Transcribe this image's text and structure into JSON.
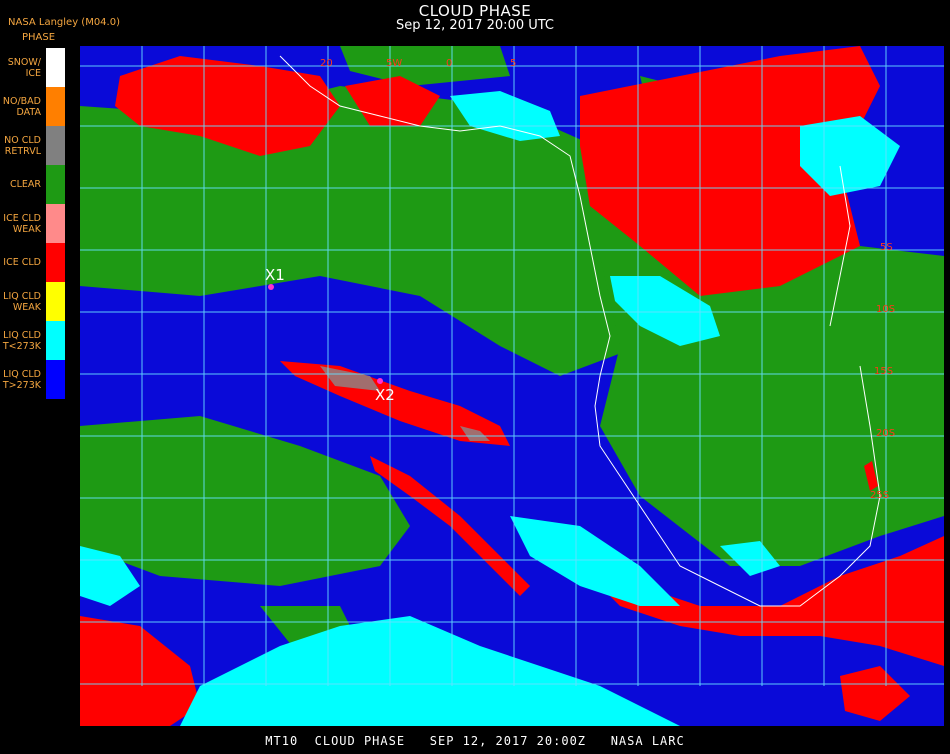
{
  "header": {
    "title": "CLOUD PHASE",
    "subtitle": "Sep 12, 2017 20:00 UTC",
    "producer": "NASA Langley (M04.0)",
    "legend_title": "PHASE"
  },
  "legend": [
    {
      "label": "SNOW/\nICE",
      "color": "#ffffff"
    },
    {
      "label": "NO/BAD\nDATA",
      "color": "#ff7f00"
    },
    {
      "label": "NO CLD\nRETRVL",
      "color": "#808080"
    },
    {
      "label": "CLEAR",
      "color": "#1e9a14"
    },
    {
      "label": "ICE CLD\nWEAK",
      "color": "#ff8a8a"
    },
    {
      "label": "ICE CLD",
      "color": "#ff0000"
    },
    {
      "label": "LIQ CLD\nWEAK",
      "color": "#ffff00"
    },
    {
      "label": "LIQ CLD\nT<273K",
      "color": "#00ffff"
    },
    {
      "label": "LIQ CLD\nT>273K",
      "color": "#0000ff"
    }
  ],
  "markers": [
    {
      "label": "X1"
    },
    {
      "label": "X2"
    }
  ],
  "lat_labels": [
    "5S",
    "10S",
    "15S",
    "20S",
    "25S"
  ],
  "top_labels": [
    "20",
    "5W",
    "0",
    "5"
  ],
  "footer": "MT10  CLOUD PHASE   SEP 12, 2017 20:00Z   NASA LARC"
}
